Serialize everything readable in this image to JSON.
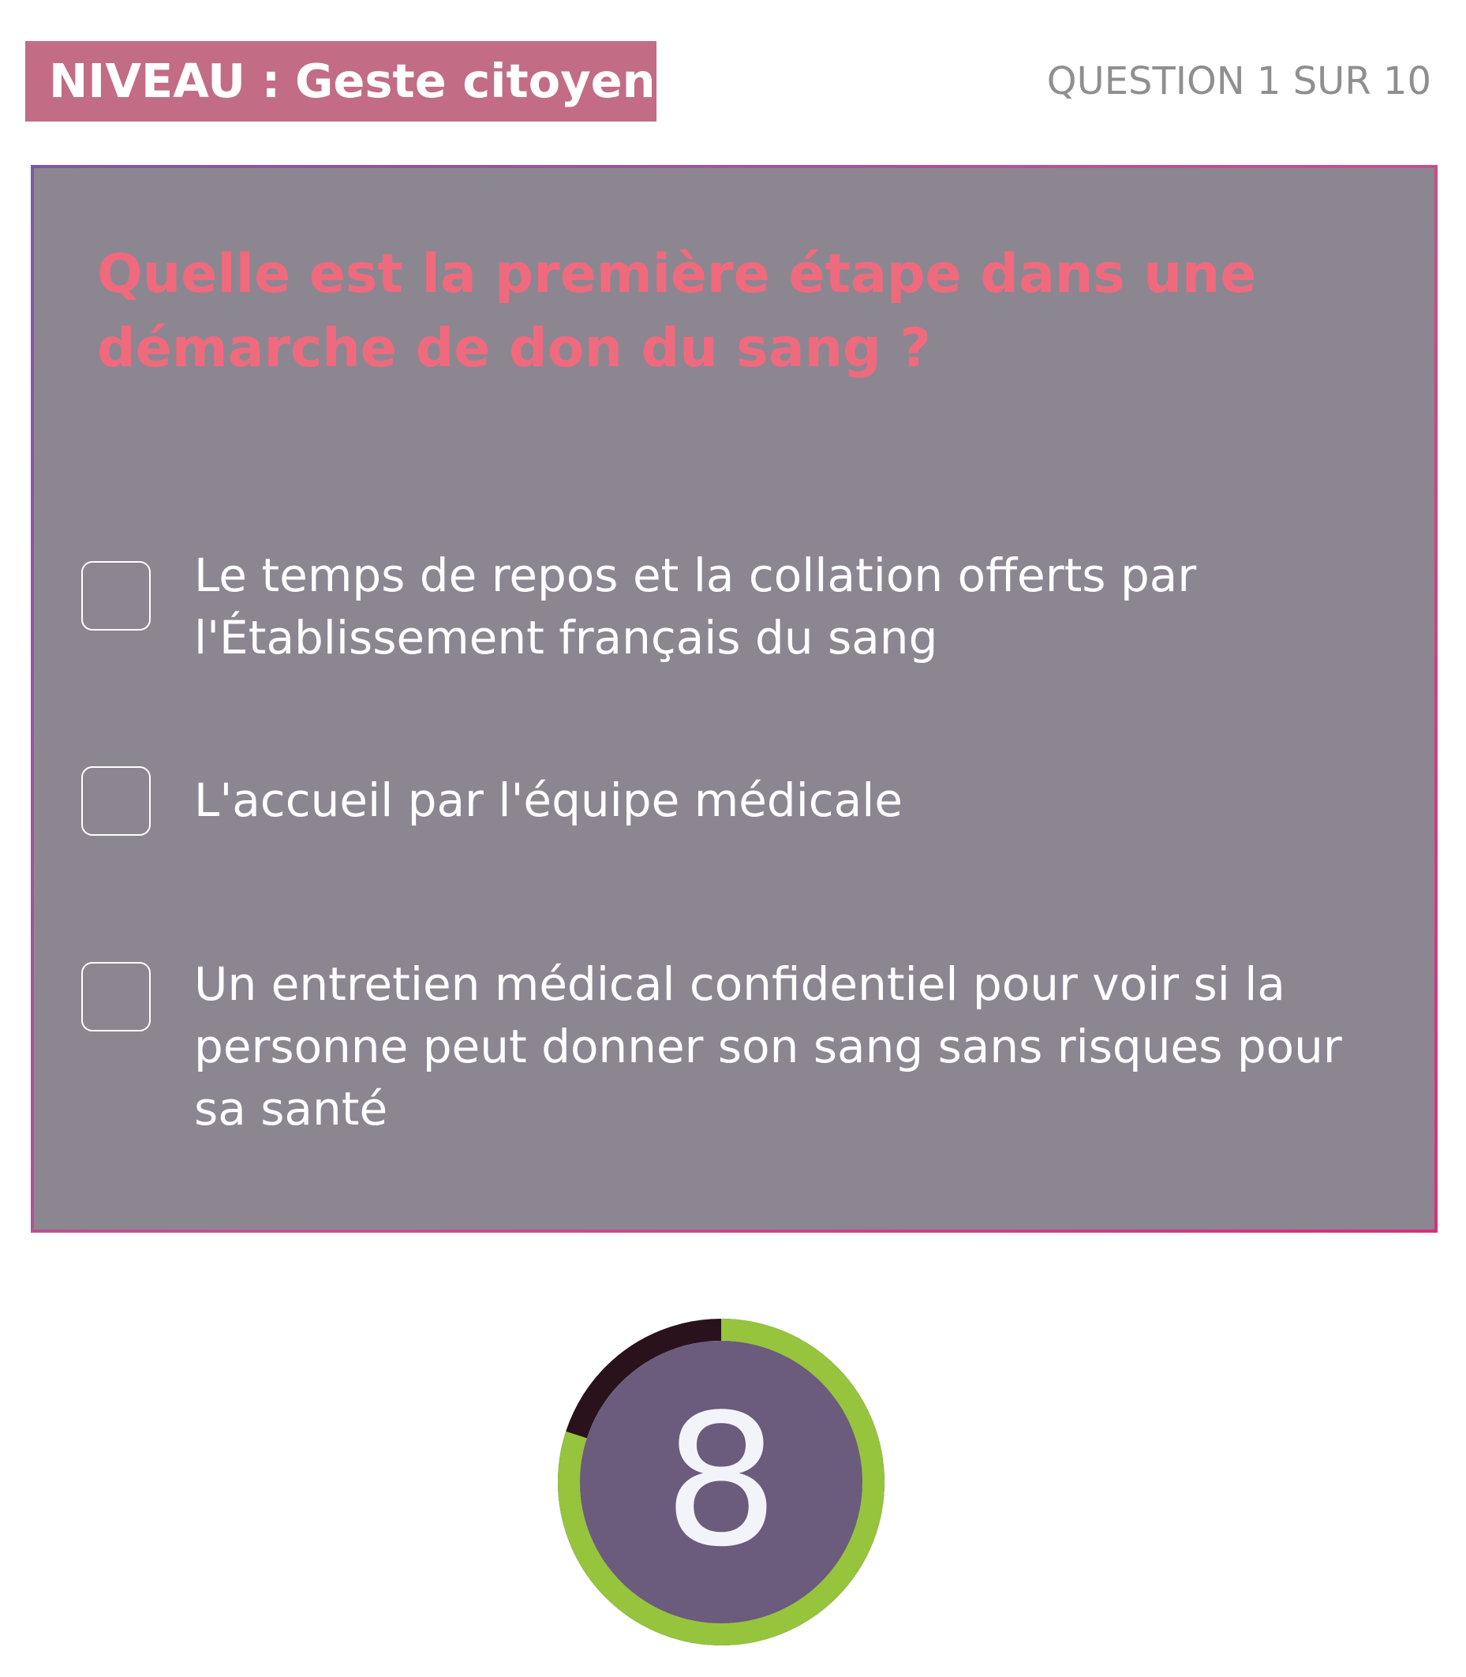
{
  "header": {
    "level_key": "NIVEAU :",
    "level_value": "Geste citoyen",
    "question_counter": "QUESTION 1 SUR 10"
  },
  "question": {
    "text": "Quelle est la première étape dans une démarche de don du sang ?"
  },
  "answers": [
    {
      "text": "Le temps de repos et la collation offerts par l'Établissement français du sang",
      "checked": false
    },
    {
      "text": "L'accueil par l'équipe médicale",
      "checked": false
    },
    {
      "text": "Un entretien médical confidentiel pour voir si la personne peut donner son sang sans risques pour sa santé",
      "checked": false
    }
  ],
  "timer": {
    "value": "8",
    "remaining_fraction": 0.8,
    "colors": {
      "remaining": "#96c43d",
      "elapsed": "#2a121d",
      "center": "#6b5b7c",
      "number": "#f3f4fa"
    }
  },
  "colors": {
    "badge_background": "#c26c85",
    "card_background": "#8c8691",
    "question_text": "#f06a7e",
    "counter_text": "#8f8f8f"
  }
}
